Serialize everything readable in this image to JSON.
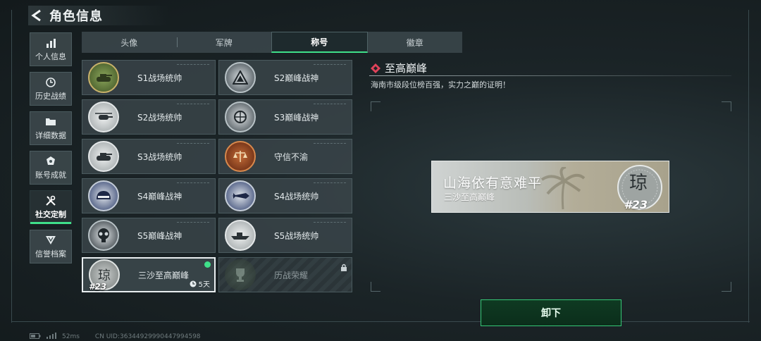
{
  "header": {
    "title": "角色信息",
    "back_icon": "back-arrow-icon"
  },
  "sidebar": {
    "items": [
      {
        "label": "个人信息",
        "icon": "bar-chart-icon"
      },
      {
        "label": "历史战绩",
        "icon": "clock-icon"
      },
      {
        "label": "详细数据",
        "icon": "folder-icon"
      },
      {
        "label": "账号成就",
        "icon": "medal-icon"
      },
      {
        "label": "社交定制",
        "icon": "tools-icon",
        "active": true
      },
      {
        "label": "信誉档案",
        "icon": "shield-icon"
      }
    ]
  },
  "tabs": [
    {
      "label": "头像"
    },
    {
      "label": "军牌"
    },
    {
      "label": "称号",
      "active": true
    },
    {
      "label": "徽章"
    }
  ],
  "titles": [
    {
      "name": "S1战场统帅",
      "badge_color": "#6c8a3e",
      "badge_icon": "tank-badge-icon"
    },
    {
      "name": "S2巅峰战神",
      "badge_color": "#2b3339",
      "badge_icon": "triangle-badge-icon"
    },
    {
      "name": "S2战场统帅",
      "badge_color": "#d9dcdc",
      "badge_icon": "helicopter-badge-icon"
    },
    {
      "name": "S3巅峰战神",
      "badge_color": "#2b3339",
      "badge_icon": "globe-badge-icon"
    },
    {
      "name": "S3战场统帅",
      "badge_color": "#d9dcdc",
      "badge_icon": "tank-badge-icon"
    },
    {
      "name": "守信不渝",
      "badge_color": "#8b3a1d",
      "badge_icon": "scales-badge-icon"
    },
    {
      "name": "S4巅峰战神",
      "badge_color": "#2c3d6b",
      "badge_icon": "helmet-badge-icon"
    },
    {
      "name": "S4战场统帅",
      "badge_color": "#2c3d6b",
      "badge_icon": "missile-badge-icon"
    },
    {
      "name": "S5巅峰战神",
      "badge_color": "#2b3339",
      "badge_icon": "gasmask-badge-icon"
    },
    {
      "name": "S5战场统帅",
      "badge_color": "#d9dcdc",
      "badge_icon": "boat-badge-icon"
    },
    {
      "name": "三沙至高巅峰",
      "badge_color": "#a3a7a6",
      "badge_icon": "palm-badge-icon",
      "badge_text": "琼",
      "badge_num": "#23",
      "selected": true,
      "time": "5天"
    },
    {
      "name": "历战荣耀",
      "badge_color": "#3b4a3c",
      "badge_icon": "trophy-badge-icon",
      "locked": true
    }
  ],
  "detail": {
    "title": "至高巅峰",
    "description": "海南市级段位榜百强，实力之巅的证明！",
    "nameplate": {
      "title": "山海依有意难平",
      "subtitle": "三沙至高巅峰",
      "emblem_text": "琼",
      "number": "#23"
    },
    "button": "卸下"
  },
  "footer": {
    "ping": "52ms",
    "uid": "CN UID:36344929990447994598"
  },
  "colors": {
    "accent": "#3fe08a",
    "bg": "#1b2427"
  }
}
